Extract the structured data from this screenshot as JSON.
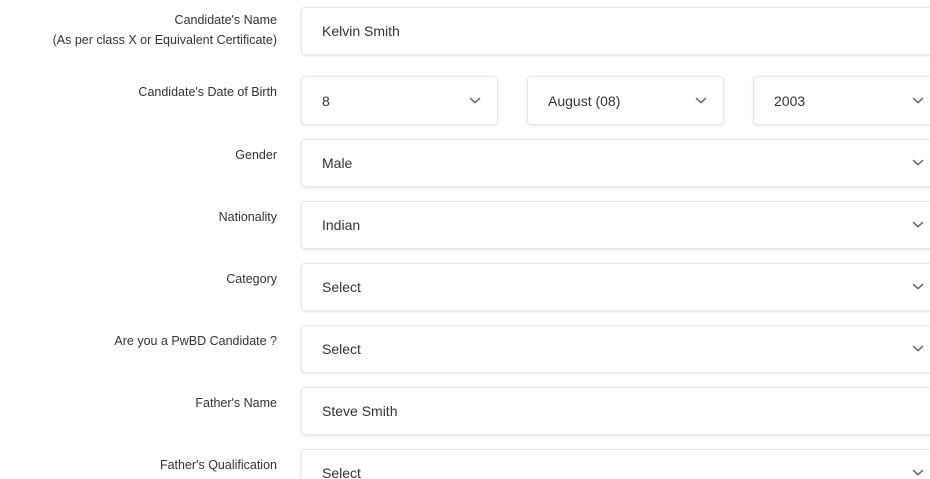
{
  "fields": {
    "name": {
      "label": "Candidate's Name",
      "sublabel": "(As per class X or Equivalent Certificate)",
      "value": "Kelvin Smith"
    },
    "dob": {
      "label": "Candidate's Date of Birth",
      "day": "8",
      "month": "August (08)",
      "year": "2003"
    },
    "gender": {
      "label": "Gender",
      "value": "Male"
    },
    "nationality": {
      "label": "Nationality",
      "value": "Indian"
    },
    "category": {
      "label": "Category",
      "value": "Select"
    },
    "pwbd": {
      "label": "Are you a PwBD Candidate ?",
      "value": "Select"
    },
    "father_name": {
      "label": "Father's Name",
      "value": "Steve Smith"
    },
    "father_qualification": {
      "label": "Father's Qualification",
      "value": "Select"
    }
  },
  "icons": {
    "dropdown": "chevron-down-icon"
  },
  "colors": {
    "border": "#e4e6ea",
    "text": "#333333",
    "chevron": "#666666"
  }
}
